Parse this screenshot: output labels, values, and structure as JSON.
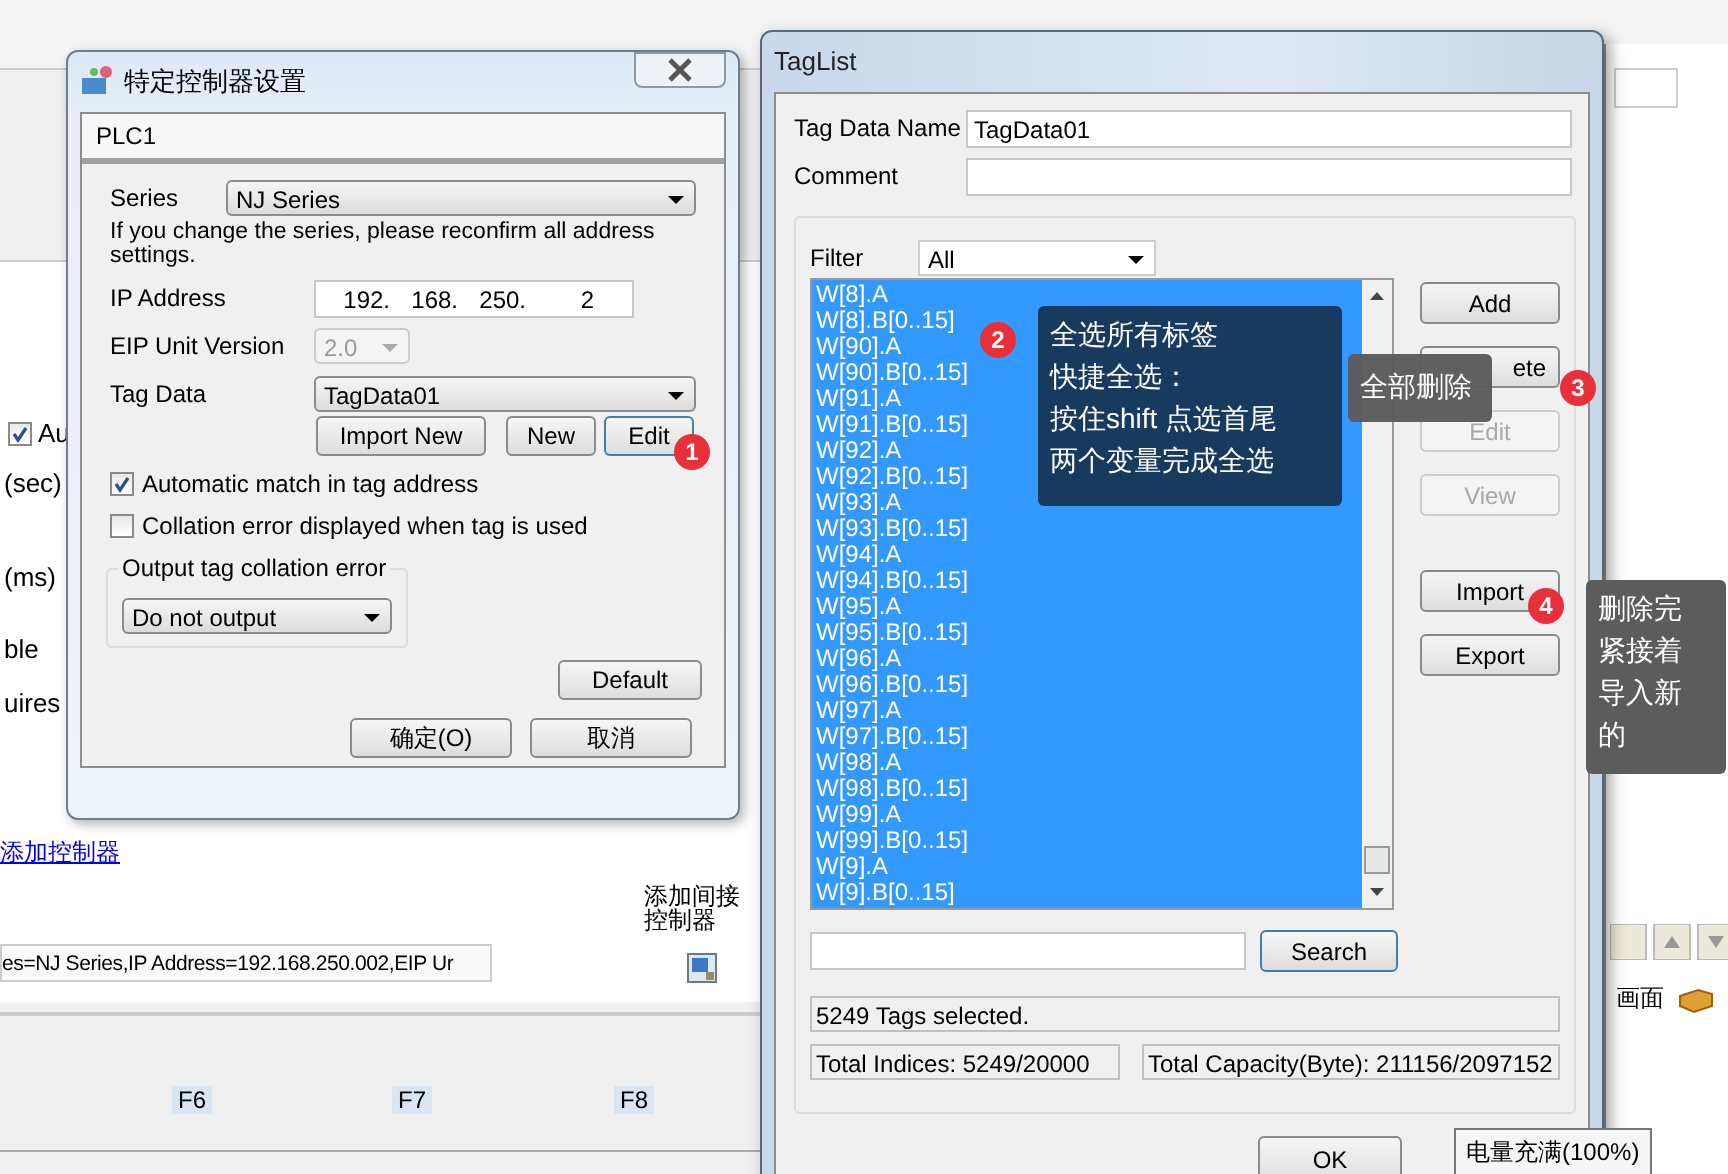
{
  "app": {
    "left_items": [
      {
        "kind": "checkbox",
        "label": "Au",
        "checked": true
      },
      {
        "kind": "text",
        "label": "(sec)"
      },
      {
        "kind": "text",
        "label": "(ms)"
      },
      {
        "kind": "text",
        "label": "ble"
      },
      {
        "kind": "text",
        "label": "uires"
      }
    ],
    "add_controller_link": "添加控制器",
    "add_indirect_label": "添加间接控制器",
    "controller_summary": "es=NJ Series,IP Address=192.168.250.002,EIP Ur",
    "function_keys": [
      "F6",
      "F7",
      "F8"
    ],
    "right_tab": "画面"
  },
  "controller_dialog": {
    "title": "特定控制器设置",
    "tab": "PLC1",
    "series": {
      "label": "Series",
      "value": "NJ Series"
    },
    "note": "If you change the series, please reconfirm all address settings.",
    "ip": {
      "label": "IP Address",
      "parts": [
        "192.",
        "168.",
        "250.",
        "2"
      ]
    },
    "eip": {
      "label": "EIP Unit Version",
      "value": "2.0",
      "disabled": true
    },
    "tag_data": {
      "label": "Tag Data",
      "value": "TagData01"
    },
    "tag_buttons": [
      "Import New",
      "New",
      "Edit"
    ],
    "checkboxes": [
      {
        "label": "Automatic match in tag address",
        "checked": true
      },
      {
        "label": "Collation error displayed when tag is used",
        "checked": false
      }
    ],
    "output_group": {
      "legend": "Output tag collation error",
      "value": "Do not output"
    },
    "default_button": "Default",
    "ok_button": "确定(O)",
    "cancel_button": "取消"
  },
  "taglist": {
    "title": "TagList",
    "name": {
      "label": "Tag Data Name",
      "value": "TagData01"
    },
    "comment": {
      "label": "Comment"
    },
    "filter": {
      "label": "Filter",
      "value": "All"
    },
    "tags": [
      {
        "name": "W[8].A",
        "selected": true
      },
      {
        "name": "W[8].B[0..15]",
        "selected": true
      },
      {
        "name": "W[90].A",
        "selected": true
      },
      {
        "name": "W[90].B[0..15]",
        "selected": true
      },
      {
        "name": "W[91].A",
        "selected": true
      },
      {
        "name": "W[91].B[0..15]",
        "selected": true
      },
      {
        "name": "W[92].A",
        "selected": true
      },
      {
        "name": "W[92].B[0..15]",
        "selected": true
      },
      {
        "name": "W[93].A",
        "selected": true
      },
      {
        "name": "W[93].B[0..15]",
        "selected": true
      },
      {
        "name": "W[94].A",
        "selected": true
      },
      {
        "name": "W[94].B[0..15]",
        "selected": true
      },
      {
        "name": "W[95].A",
        "selected": true
      },
      {
        "name": "W[95].B[0..15]",
        "selected": true
      },
      {
        "name": "W[96].A",
        "selected": true
      },
      {
        "name": "W[96].B[0..15]",
        "selected": true
      },
      {
        "name": "W[97].A",
        "selected": true
      },
      {
        "name": "W[97].B[0..15]",
        "selected": true
      },
      {
        "name": "W[98].A",
        "selected": true
      },
      {
        "name": "W[98].B[0..15]",
        "selected": true
      },
      {
        "name": "W[99].A",
        "selected": true
      },
      {
        "name": "W[99].B[0..15]",
        "selected": true
      },
      {
        "name": "W[9].A",
        "selected": true
      },
      {
        "name": "W[9].B[0..15]",
        "selected": true
      }
    ],
    "buttons": [
      {
        "label": "Add",
        "disabled": false
      },
      {
        "label": "ete",
        "disabled": false
      },
      {
        "label": "Edit",
        "disabled": true
      },
      {
        "label": "View",
        "disabled": true
      },
      {
        "label": "Import",
        "disabled": false
      },
      {
        "label": "Export",
        "disabled": false
      }
    ],
    "search_button": "Search",
    "status": "5249 Tags selected.",
    "total_indices": "Total Indices: 5249/20000",
    "total_capacity": "Total Capacity(Byte): 211156/2097152",
    "ok_button": "OK"
  },
  "callouts": [
    {
      "number": "1"
    },
    {
      "number": "2",
      "lines": [
        "全选所有标签",
        "快捷全选：",
        "按住shift 点选首尾",
        "两个变量完成全选"
      ]
    },
    {
      "number": "3",
      "lines": [
        "全部删除"
      ]
    },
    {
      "number": "4",
      "lines": [
        "删除完",
        "紧接着",
        "导入新",
        "的"
      ]
    }
  ],
  "tooltip": "电量充满(100%)"
}
